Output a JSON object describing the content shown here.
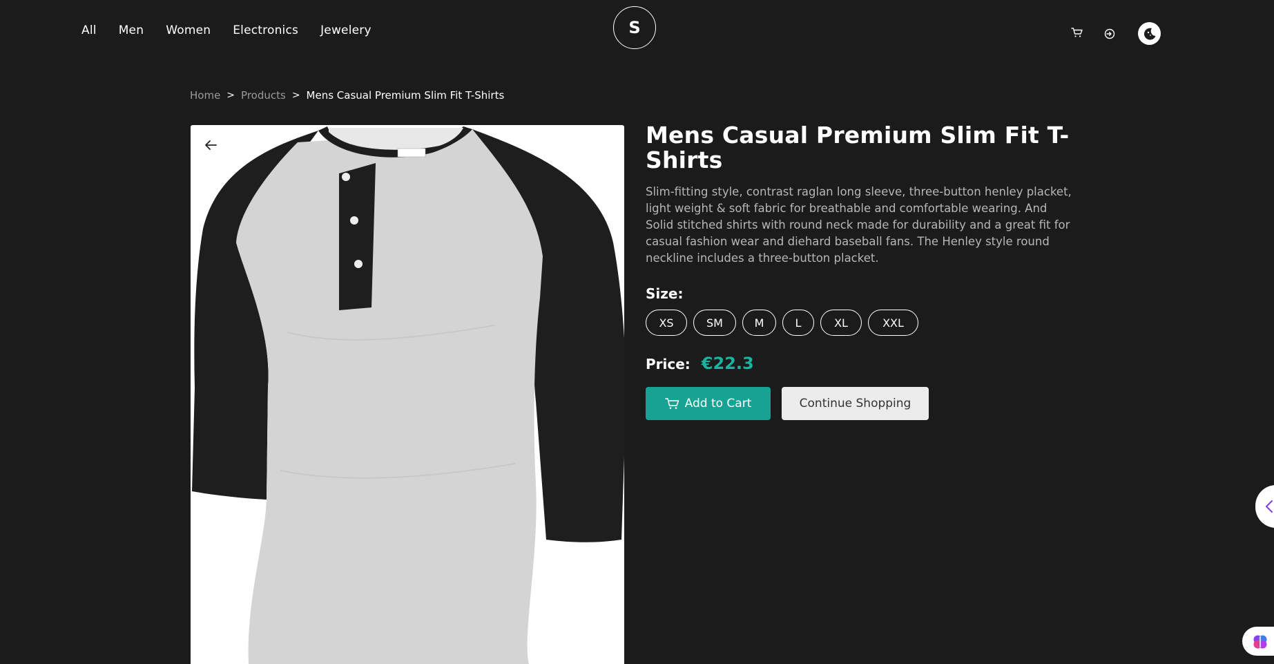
{
  "nav": {
    "links": [
      "All",
      "Men",
      "Women",
      "Electronics",
      "Jewelery"
    ],
    "logo_letter": "S",
    "icons": [
      "cart-icon",
      "login-icon",
      "moon-icon"
    ]
  },
  "breadcrumb": {
    "home": "Home",
    "sep": ">",
    "products": "Products",
    "current": "Mens Casual Premium Slim Fit T-Shirts"
  },
  "product": {
    "title": "Mens Casual Premium Slim Fit T-Shirts",
    "description": "Slim-fitting style, contrast raglan long sleeve, three-button henley placket, light weight & soft fabric for breathable and comfortable wearing. And Solid stitched shirts with round neck made for durability and a great fit for casual fashion wear and diehard baseball fans. The Henley style round neckline includes a three-button placket.",
    "size_label": "Size:",
    "sizes": [
      "XS",
      "SM",
      "M",
      "L",
      "XL",
      "XXL"
    ],
    "price_label": "Price:",
    "price": "€22.3",
    "add_to_cart": "Add to Cart",
    "continue_shopping": "Continue Shopping"
  },
  "colors": {
    "background": "#1b1b1b",
    "accent": "#16a394",
    "price": "#19b3a0"
  }
}
